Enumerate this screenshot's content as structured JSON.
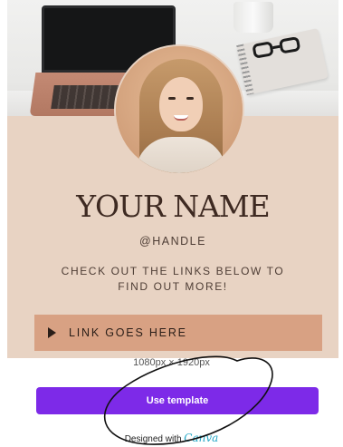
{
  "card": {
    "name": "YOUR NAME",
    "handle": "@HANDLE",
    "cta_line1": "CHECK OUT THE LINKS BELOW TO",
    "cta_line2": "FIND OUT MORE!",
    "link_label": "LINK GOES HERE",
    "link_icon": "play-triangle-icon"
  },
  "template": {
    "dimensions": "1080px × 1920px",
    "use_button": "Use template",
    "designed_with": "Designed with",
    "brand": "Canva"
  },
  "colors": {
    "card_background": "#e8d3c3",
    "link_bar": "#d8a183",
    "name_text": "#3e2a22",
    "button": "#7d2ae8",
    "brand": "#24a7c6"
  }
}
